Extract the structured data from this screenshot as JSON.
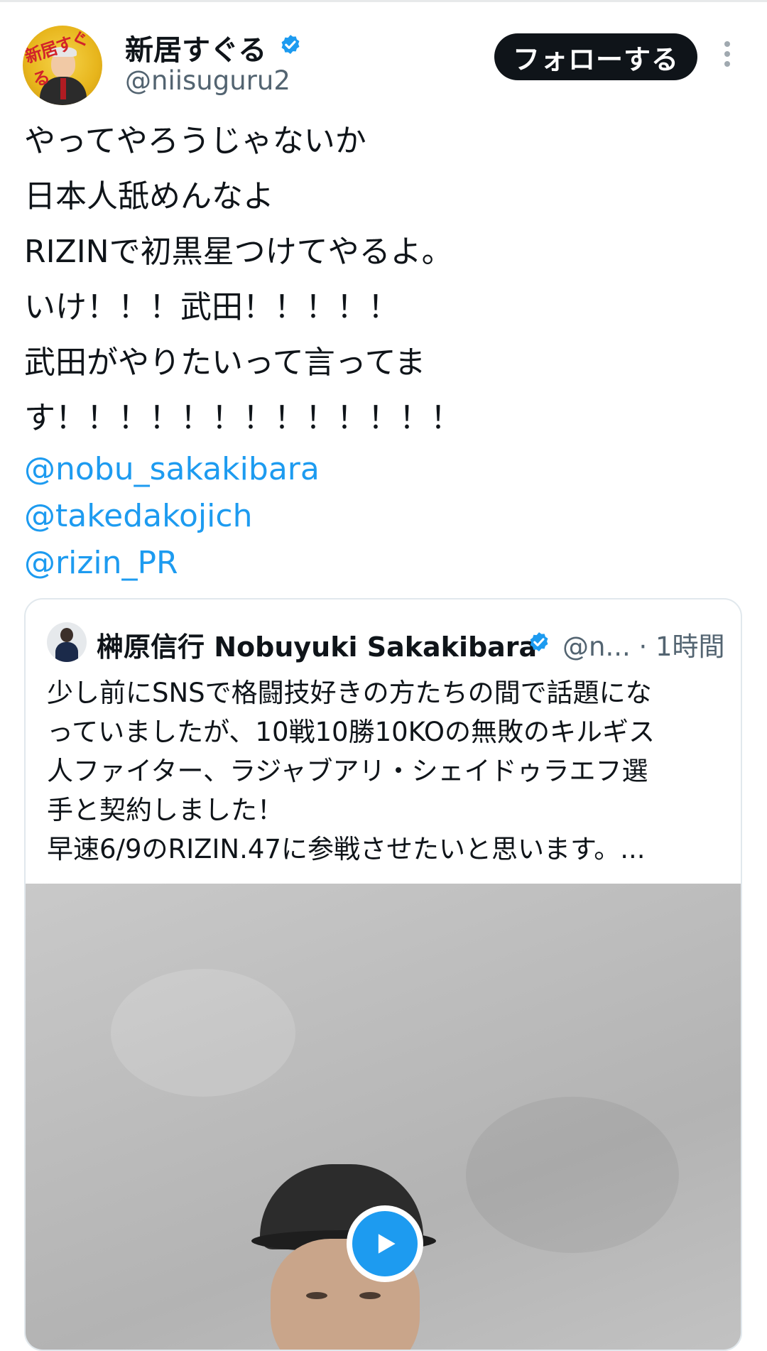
{
  "tweet": {
    "author": {
      "display_name": "新居すぐる",
      "handle": "@niisuguru2",
      "avatar_text": "新居すぐる"
    },
    "follow_label": "フォローする",
    "text_lines": [
      "やってやろうじゃないか",
      "日本人舐めんなよ",
      "RIZINで初黒星つけてやるよ。",
      "いけ！！！武田！！！！！",
      "武田がやりたいって言ってま",
      "す！！！！！！！！！！！！！"
    ],
    "mentions": [
      "@nobu_sakakibara",
      "@takedakojich",
      "@rizin_PR"
    ]
  },
  "quoted_tweet": {
    "display_name": "榊原信行 Nobuyuki Sakakibara",
    "meta": "@n... · 1時間",
    "text_lines": [
      "少し前にSNSで格闘技好きの方たちの間で話題にな",
      "っていましたが、10戦10勝10KOの無敗のキルギス",
      "人ファイター、ラジャブアリ・シェイドゥラエフ選",
      "手と契約しました！",
      "早速6/9のRIZIN.47に参戦させたいと思います。..."
    ]
  },
  "colors": {
    "accent": "#1d9bf0",
    "text_primary": "#0f1419",
    "text_secondary": "#536471",
    "follow_bg": "#0f1419"
  },
  "icons": {
    "verified": "verified-badge-icon",
    "more": "more-vertical-icon",
    "play": "play-icon"
  }
}
